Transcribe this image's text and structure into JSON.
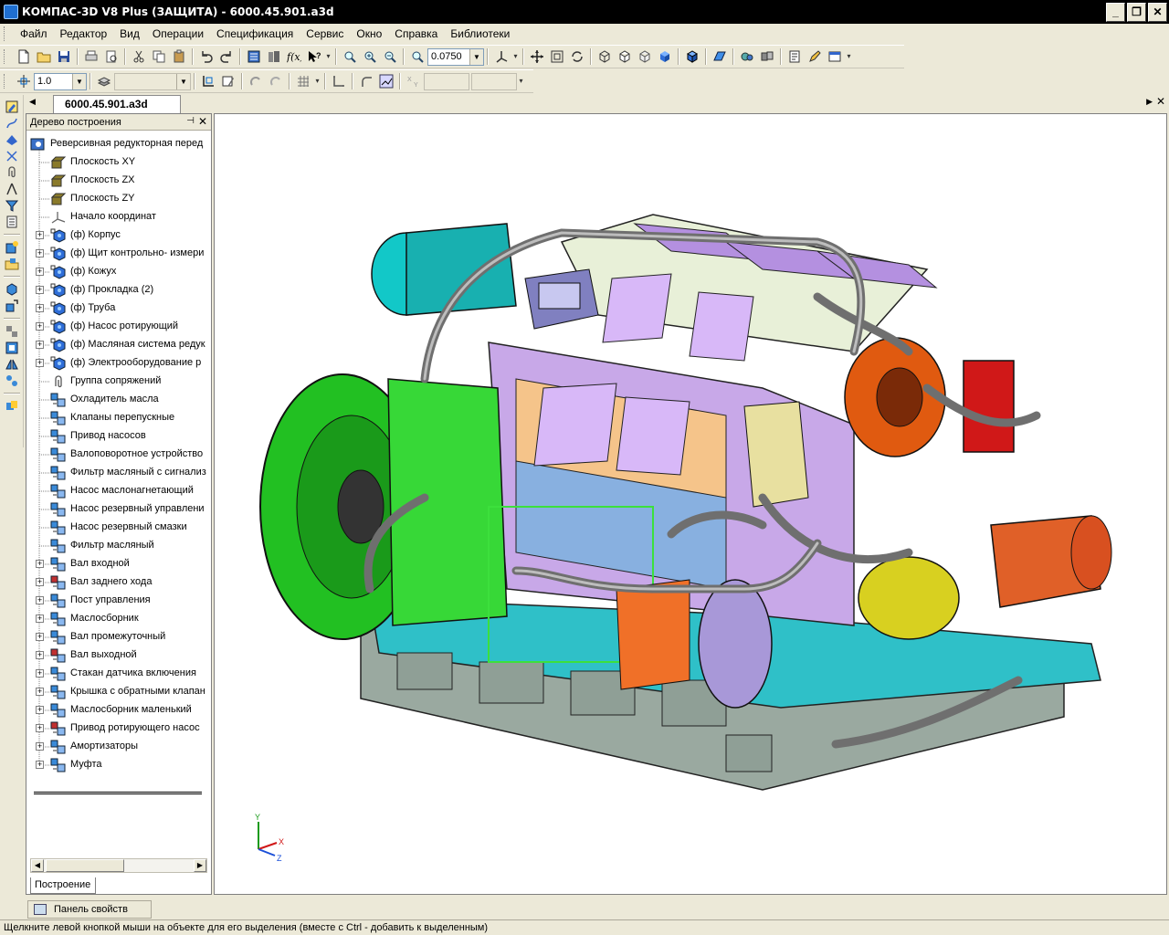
{
  "window": {
    "title": "КОМПАС-3D V8 Plus (ЗАЩИТА) - 6000.45.901.a3d",
    "minimize": "_",
    "restore": "❐",
    "close": "✕"
  },
  "menu": [
    {
      "label": "Файл"
    },
    {
      "label": "Редактор"
    },
    {
      "label": "Вид"
    },
    {
      "label": "Операции"
    },
    {
      "label": "Спецификация"
    },
    {
      "label": "Сервис"
    },
    {
      "label": "Окно"
    },
    {
      "label": "Справка"
    },
    {
      "label": "Библиотеки"
    }
  ],
  "toolbar": {
    "zoom_value": "0.0750",
    "step_value": "1.0"
  },
  "tabs": {
    "document": "6000.45.901.a3d"
  },
  "tree": {
    "header": "Дерево построения",
    "pin": "⊣",
    "close": "✕",
    "bottom_tab": "Построение",
    "items": [
      {
        "label": "Реверсивная редукторная перед",
        "level": 0,
        "expand": false,
        "icon": "assembly-root"
      },
      {
        "label": "Плоскость XY",
        "level": 1,
        "expand": false,
        "icon": "plane"
      },
      {
        "label": "Плоскость ZX",
        "level": 1,
        "expand": false,
        "icon": "plane"
      },
      {
        "label": "Плоскость ZY",
        "level": 1,
        "expand": false,
        "icon": "plane"
      },
      {
        "label": "Начало координат",
        "level": 1,
        "expand": false,
        "icon": "origin"
      },
      {
        "label": "(ф) Корпус",
        "level": 1,
        "expand": true,
        "icon": "part"
      },
      {
        "label": "(ф) Щит контрольно- измери",
        "level": 1,
        "expand": true,
        "icon": "part"
      },
      {
        "label": "(ф) Кожух",
        "level": 1,
        "expand": true,
        "icon": "part"
      },
      {
        "label": "(ф) Прокладка (2)",
        "level": 1,
        "expand": true,
        "icon": "part"
      },
      {
        "label": "(ф) Труба",
        "level": 1,
        "expand": true,
        "icon": "part"
      },
      {
        "label": "(ф) Насос ротирующий",
        "level": 1,
        "expand": true,
        "icon": "part"
      },
      {
        "label": "(ф) Масляная система редук",
        "level": 1,
        "expand": true,
        "icon": "part"
      },
      {
        "label": "(ф) Электрооборудование р",
        "level": 1,
        "expand": true,
        "icon": "part"
      },
      {
        "label": "Группа сопряжений",
        "level": 1,
        "expand": false,
        "icon": "mates"
      },
      {
        "label": "Охладитель масла",
        "level": 1,
        "expand": false,
        "icon": "subassembly"
      },
      {
        "label": "Клапаны перепускные",
        "level": 1,
        "expand": false,
        "icon": "subassembly"
      },
      {
        "label": "Привод насосов",
        "level": 1,
        "expand": false,
        "icon": "subassembly"
      },
      {
        "label": "Валоповоротное устройство",
        "level": 1,
        "expand": false,
        "icon": "subassembly"
      },
      {
        "label": "Фильтр масляный с сигнализ",
        "level": 1,
        "expand": false,
        "icon": "subassembly"
      },
      {
        "label": "Насос маслонагнетающий",
        "level": 1,
        "expand": false,
        "icon": "subassembly"
      },
      {
        "label": "Насос резервный управлени",
        "level": 1,
        "expand": false,
        "icon": "subassembly"
      },
      {
        "label": "Насос резервный смазки",
        "level": 1,
        "expand": false,
        "icon": "subassembly"
      },
      {
        "label": "Фильтр масляный",
        "level": 1,
        "expand": false,
        "icon": "subassembly"
      },
      {
        "label": "Вал входной",
        "level": 1,
        "expand": true,
        "icon": "subassembly"
      },
      {
        "label": "Вал заднего хода",
        "level": 1,
        "expand": true,
        "icon": "subassembly-red"
      },
      {
        "label": "Пост управления",
        "level": 1,
        "expand": true,
        "icon": "subassembly"
      },
      {
        "label": "Маслосборник",
        "level": 1,
        "expand": true,
        "icon": "subassembly"
      },
      {
        "label": "Вал промежуточный",
        "level": 1,
        "expand": true,
        "icon": "subassembly"
      },
      {
        "label": "Вал выходной",
        "level": 1,
        "expand": true,
        "icon": "subassembly-red"
      },
      {
        "label": "Стакан датчика включения",
        "level": 1,
        "expand": true,
        "icon": "subassembly"
      },
      {
        "label": "Крышка с обратными клапан",
        "level": 1,
        "expand": true,
        "icon": "subassembly"
      },
      {
        "label": "Маслосборник маленький",
        "level": 1,
        "expand": true,
        "icon": "subassembly"
      },
      {
        "label": "Привод ротирующего насос",
        "level": 1,
        "expand": true,
        "icon": "subassembly-red"
      },
      {
        "label": "Амортизаторы",
        "level": 1,
        "expand": true,
        "icon": "subassembly"
      },
      {
        "label": "Муфта",
        "level": 1,
        "expand": true,
        "icon": "subassembly"
      }
    ]
  },
  "axes": {
    "x": "X",
    "y": "Y",
    "z": "Z"
  },
  "properties_panel": {
    "label": "Панель свойств"
  },
  "status": {
    "text": "Щелкните левой кнопкой мыши на объекте для его выделения (вместе с Ctrl - добавить к выделенным)"
  },
  "colors": {
    "accent_blue": "#1f6fd0",
    "body_green": "#22c022",
    "cyan": "#20c8c8",
    "orange": "#e05a10",
    "lavender": "#c8a8e8",
    "gray_pipe": "#8f8f8f"
  }
}
